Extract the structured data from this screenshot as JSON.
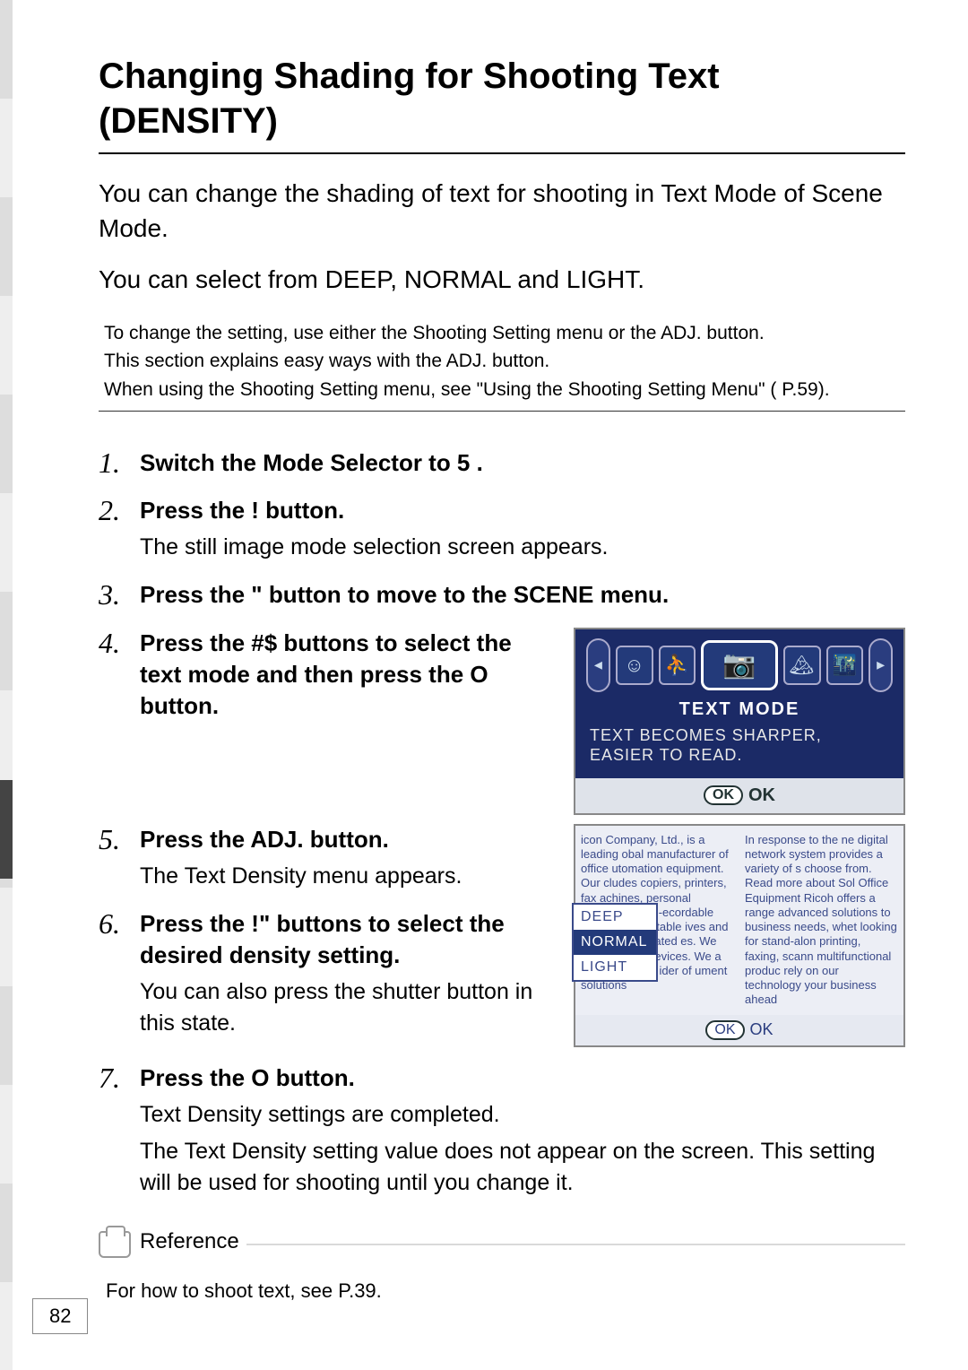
{
  "title": "Changing Shading for Shooting Text (DENSITY)",
  "intro_line1": "You can change the shading of text for shooting in Text Mode of Scene Mode.",
  "intro_line2": "You can select from DEEP, NORMAL and LIGHT.",
  "note": {
    "l1": "To change the setting, use either the Shooting Setting menu or the ADJ. button.",
    "l2": "This section explains easy ways with the ADJ. button.",
    "l3": "When using the Shooting Setting menu, see \"Using the Shooting Setting Menu\" ( P.59)."
  },
  "steps": {
    "s1": {
      "num": "1.",
      "title": "Switch the Mode Selector to 5 ."
    },
    "s2": {
      "num": "2.",
      "title": "Press the ! button.",
      "text": "The still image mode selection screen appears."
    },
    "s3": {
      "num": "3.",
      "title": "Press the \" button to move to the SCENE menu."
    },
    "s4": {
      "num": "4.",
      "title": "Press the #$ buttons to select the text mode and then press the O button."
    },
    "s5": {
      "num": "5.",
      "title": "Press the ADJ. button.",
      "text": "The Text Density menu appears."
    },
    "s6": {
      "num": "6.",
      "title": "Press the !\" buttons to select the desired density setting.",
      "text": "You can also press the shutter button in this state."
    },
    "s7": {
      "num": "7.",
      "title": "Press the O button.",
      "text1": "Text Density settings are completed.",
      "text2": "The Text Density setting value does not appear on the screen. This setting will be used for shooting until you change it."
    }
  },
  "screen1": {
    "mode_label": "TEXT MODE",
    "desc": "TEXT BECOMES SHARPER, EASIER TO READ.",
    "ok": "OK",
    "ok_pill": "OK"
  },
  "screen2": {
    "left_text": "icon Company, Ltd., is a leading obal manufacturer of office utomation equipment. Our cludes copiers, printers, fax achines, personal computers, CD-ecordable and CD-ReWritable ives and media, and related es. We are also and devices. We a solid presence ider of ument solutions",
    "right_text": "In response to the ne digital network system provides a variety of s choose from. Read more about Sol Office Equipment Ricoh offers a range advanced solutions to business needs, whet looking for stand-alon printing, faxing, scann multifunctional produc rely on our technology your business ahead",
    "menu": {
      "deep": "DEEP",
      "normal": "NORMAL",
      "light": "LIGHT"
    },
    "ok": "OK",
    "ok_pill": "OK"
  },
  "reference": {
    "label": "Reference",
    "text": "For how to shoot text, see P.39."
  },
  "page_number": "82"
}
